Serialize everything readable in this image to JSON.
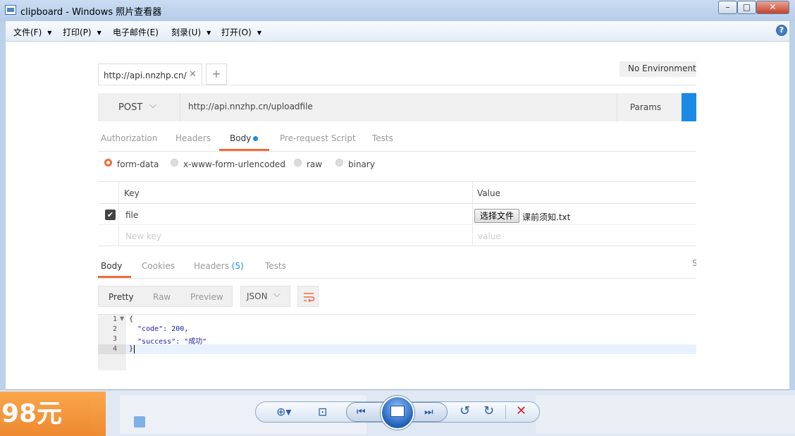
{
  "window": {
    "title": "clipboard - Windows 照片查看器",
    "minimize": "–",
    "maximize": "□",
    "close": "✕"
  },
  "menu": {
    "items": [
      "文件(F)",
      "打印(P)",
      "电子邮件(E)",
      "刻录(U)",
      "打开(O)"
    ],
    "help": "?"
  },
  "postman": {
    "tab_url": "http://api.nnzhp.cn/",
    "tab_close": "✕",
    "tab_add": "+",
    "environment": "No Environment",
    "method": "POST",
    "method_chevron": "⌵",
    "request_url": "http://api.nnzhp.cn/uploadfile",
    "params_label": "Params",
    "request_tabs": [
      "Authorization",
      "Headers",
      "Body",
      "Pre-request Script",
      "Tests"
    ],
    "body_types": [
      "form-data",
      "x-www-form-urlencoded",
      "raw",
      "binary"
    ],
    "kv_headers": {
      "key": "Key",
      "value": "Value"
    },
    "row": {
      "key": "file",
      "file_button": "选择文件",
      "file_name": "课前须知.txt",
      "check": "✔"
    },
    "new_row": {
      "key_placeholder": "New key",
      "value_placeholder": "value"
    },
    "response_tabs": [
      "Body",
      "Cookies",
      "Headers",
      "Tests"
    ],
    "headers_count": "(5)",
    "response_side": "S",
    "view_modes": [
      "Pretty",
      "Raw",
      "Preview"
    ],
    "format": "JSON",
    "format_chevron": "⌵",
    "code": {
      "line_numbers": [
        "1",
        "2",
        "3",
        "4"
      ],
      "fold": "▼",
      "lines": [
        "{",
        "  \"code\": 200,",
        "  \"success\": \"成功\"",
        "}"
      ]
    }
  },
  "background": {
    "ad_text": "98元"
  },
  "viewer_controls": {
    "zoom": "⊕▾",
    "fit": "⊡",
    "prev": "⏮",
    "next": "⏭",
    "rotate_ccw": "↺",
    "rotate_cw": "↻",
    "delete": "✕"
  },
  "colors": {
    "accent_orange": "#f26b3a",
    "send_blue": "#1b8ae6"
  }
}
